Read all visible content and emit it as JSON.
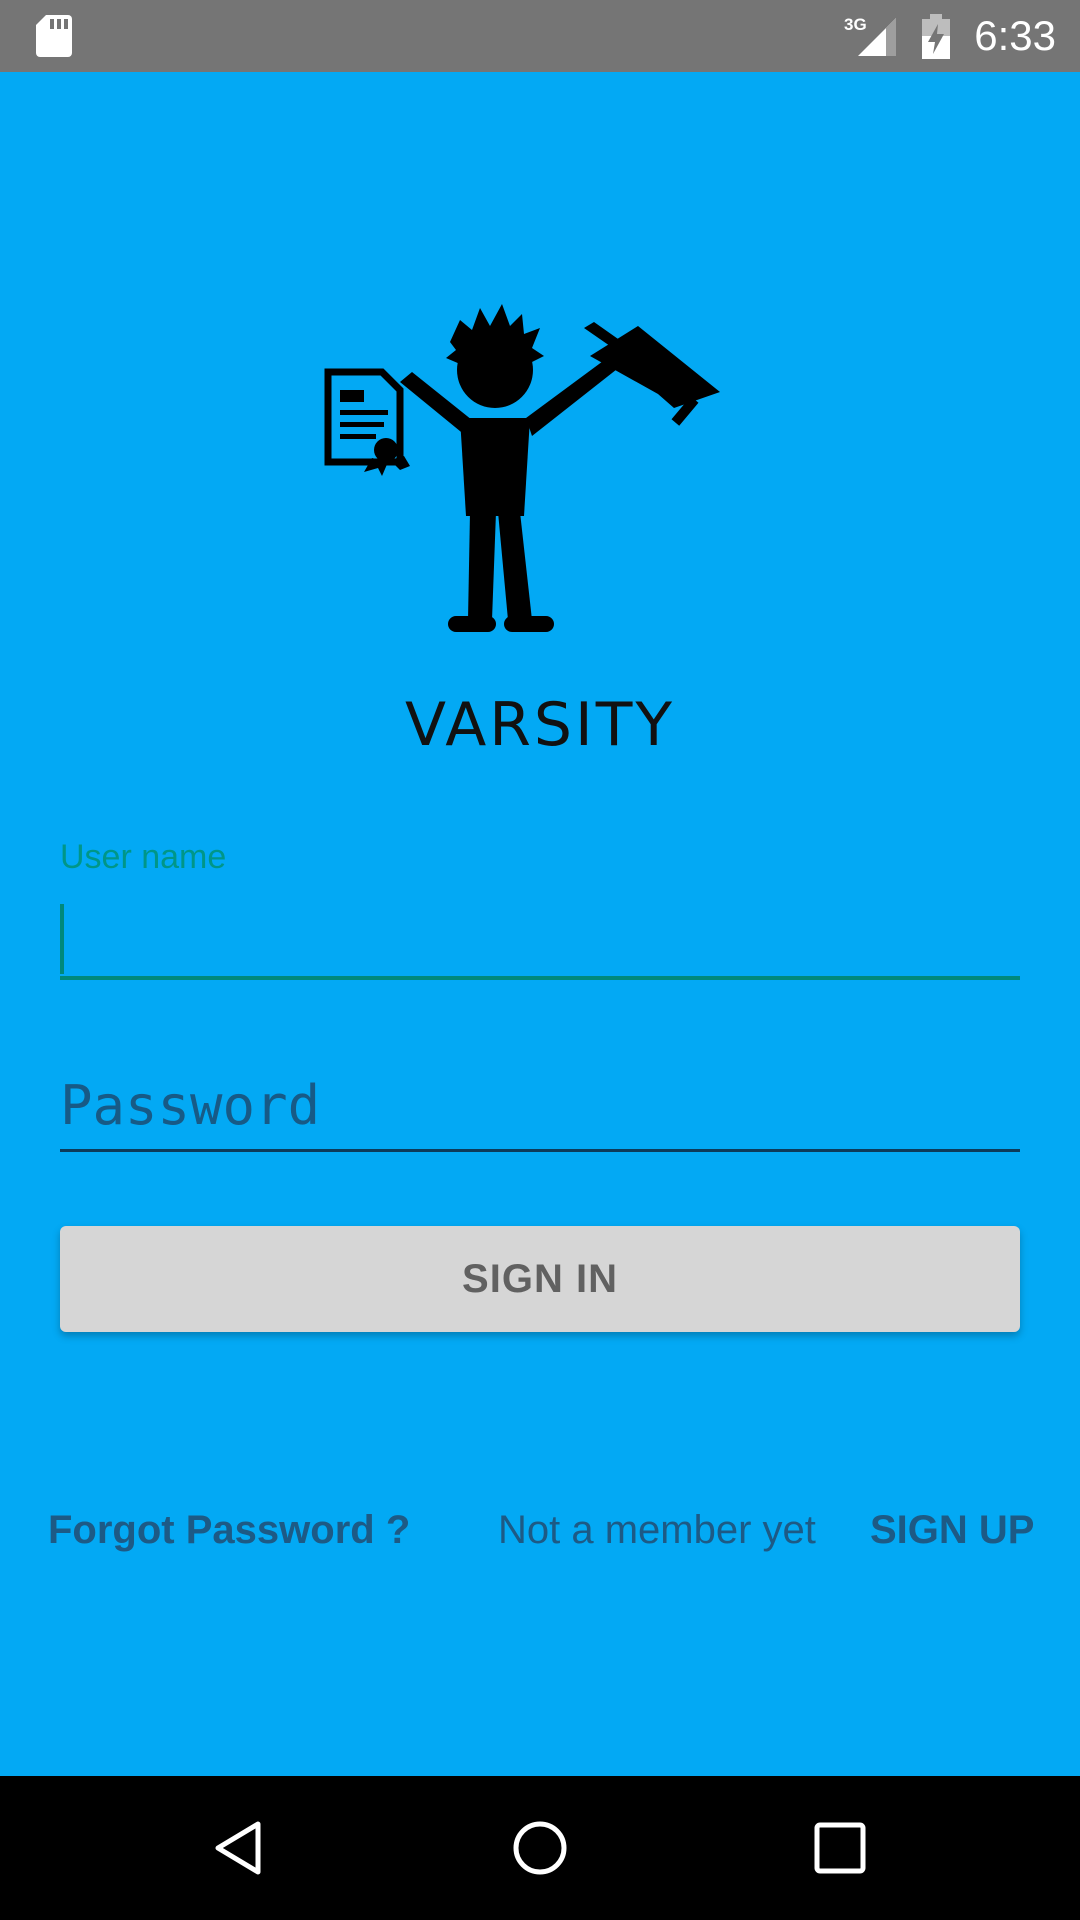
{
  "status_bar": {
    "network": "3G",
    "time": "6:33",
    "icons": [
      "sd-card-icon",
      "signal-icon",
      "battery-charging-icon"
    ]
  },
  "brand": {
    "name": "VARSITY"
  },
  "form": {
    "username_label": "User name",
    "username_value": "",
    "password_placeholder": "Password",
    "signin_label": "SIGN IN"
  },
  "footer": {
    "forgot_label": "Forgot Password ?",
    "not_member_text": "Not a member yet",
    "signup_label": "SIGN UP"
  },
  "nav_bar": {
    "icons": [
      "back-icon",
      "home-icon",
      "recent-apps-icon"
    ]
  },
  "colors": {
    "background": "#03a9f4",
    "accent": "#009688",
    "status_bar": "#757575",
    "button": "#d6d6d6",
    "link_text": "#1d5a85"
  }
}
